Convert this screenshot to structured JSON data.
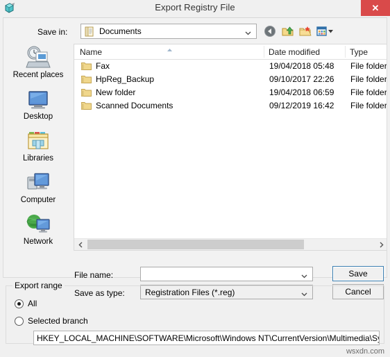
{
  "window": {
    "title": "Export Registry File",
    "icon": "registry-editor-icon",
    "close_label": "✕",
    "close_color": "#d94a4a"
  },
  "saveIn": {
    "label": "Save in:",
    "value": "Documents",
    "icon": "documents-folder-icon",
    "toolbar": [
      {
        "name": "back-button",
        "icon": "back-arrow-icon"
      },
      {
        "name": "up-one-level-button",
        "icon": "up-folder-icon"
      },
      {
        "name": "new-folder-button",
        "icon": "new-folder-icon"
      },
      {
        "name": "views-button",
        "icon": "views-icon"
      }
    ]
  },
  "places": [
    {
      "label": "Recent places",
      "icon": "recent-places-icon"
    },
    {
      "label": "Desktop",
      "icon": "desktop-icon"
    },
    {
      "label": "Libraries",
      "icon": "libraries-icon"
    },
    {
      "label": "Computer",
      "icon": "computer-icon"
    },
    {
      "label": "Network",
      "icon": "network-icon"
    }
  ],
  "fileList": {
    "columns": [
      "Name",
      "Date modified",
      "Type"
    ],
    "sort": {
      "column": "Name",
      "direction": "ascending"
    },
    "rows": [
      {
        "name": "Fax",
        "date": "19/04/2018 05:48",
        "type": "File folder",
        "icon": "folder-icon"
      },
      {
        "name": "HpReg_Backup",
        "date": "09/10/2017 22:26",
        "type": "File folder",
        "icon": "folder-icon"
      },
      {
        "name": "New folder",
        "date": "19/04/2018 06:59",
        "type": "File folder",
        "icon": "folder-icon"
      },
      {
        "name": "Scanned Documents",
        "date": "09/12/2019 16:42",
        "type": "File folder",
        "icon": "folder-icon"
      }
    ]
  },
  "fields": {
    "fileName": {
      "label": "File name:",
      "value": "",
      "placeholder": ""
    },
    "saveAsType": {
      "label": "Save as type:",
      "value": "Registration Files (*.reg)"
    }
  },
  "buttons": {
    "save": "Save",
    "cancel": "Cancel"
  },
  "exportRange": {
    "title": "Export range",
    "options": [
      {
        "label": "All",
        "selected": true
      },
      {
        "label": "Selected branch",
        "selected": false
      }
    ],
    "branchPath": "HKEY_LOCAL_MACHINE\\SOFTWARE\\Microsoft\\Windows NT\\CurrentVersion\\Multimedia\\SystemProfile"
  },
  "watermark": "wsxdn.com"
}
